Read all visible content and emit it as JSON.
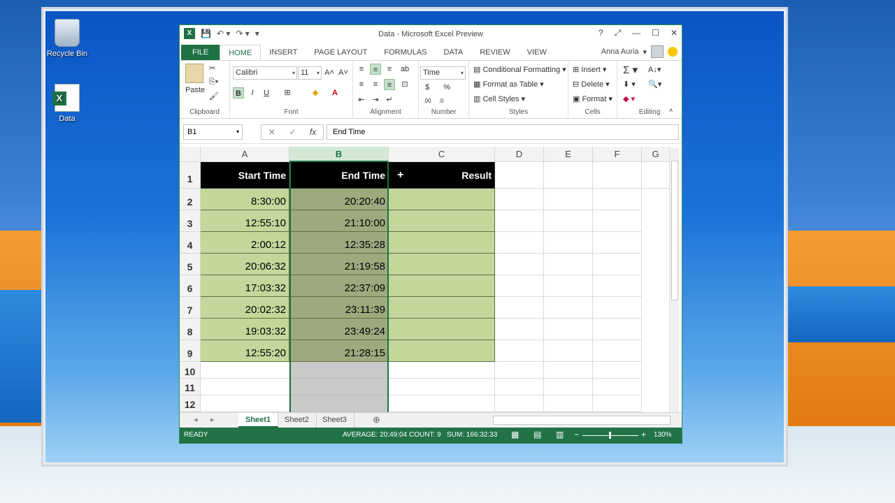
{
  "desktop": {
    "icons": [
      {
        "label": "Recycle Bin",
        "name": "recycle-bin-icon"
      },
      {
        "label": "Data",
        "name": "excel-file-icon"
      }
    ]
  },
  "window": {
    "title": "Data - Microsoft Excel Preview",
    "user": "Anna Auria",
    "controls": [
      "?",
      "⤢",
      "—",
      "☐",
      "✕"
    ]
  },
  "tabs": [
    "FILE",
    "HOME",
    "INSERT",
    "PAGE LAYOUT",
    "FORMULAS",
    "DATA",
    "REVIEW",
    "VIEW"
  ],
  "ribbon": {
    "clipboard": {
      "label": "Clipboard",
      "paste": "Paste"
    },
    "font": {
      "label": "Font",
      "name": "Calibri",
      "size": "11",
      "bold": "B",
      "italic": "I",
      "underline": "U"
    },
    "alignment": {
      "label": "Alignment"
    },
    "number": {
      "label": "Number",
      "format": "Time",
      "currency": "$",
      "percent": "%"
    },
    "styles": {
      "label": "Styles",
      "conditional": "Conditional Formatting",
      "table": "Format as Table",
      "cell": "Cell Styles"
    },
    "cells": {
      "label": "Cells",
      "insert": "Insert",
      "delete": "Delete",
      "format": "Format"
    },
    "editing": {
      "label": "Editing"
    }
  },
  "formula": {
    "namebox": "B1",
    "fx": "fx",
    "content": "End Time"
  },
  "grid": {
    "columns": [
      "A",
      "B",
      "C",
      "D",
      "E",
      "F",
      "G"
    ],
    "rows": [
      "1",
      "2",
      "3",
      "4",
      "5",
      "6",
      "7",
      "8",
      "9",
      "10",
      "11",
      "12"
    ],
    "headers": {
      "a": "Start Time",
      "b": "End Time",
      "c": "Result",
      "c_icon": "+"
    },
    "start_times": [
      "8:30:00",
      "12:55:10",
      "2:00:12",
      "20:06:32",
      "17:03:32",
      "20:02:32",
      "19:03:32",
      "12:55:20"
    ],
    "end_times": [
      "20:20:40",
      "21:10:00",
      "12:35:28",
      "21:19:58",
      "22:37:09",
      "23:11:39",
      "23:49:24",
      "21:28:15"
    ]
  },
  "sheets": [
    "Sheet1",
    "Sheet2",
    "Sheet3"
  ],
  "status": {
    "mode": "READY",
    "average": "AVERAGE: 20:49:04",
    "count": "COUNT: 9",
    "sum": "SUM: 166:32:33",
    "zoom": "130%"
  }
}
